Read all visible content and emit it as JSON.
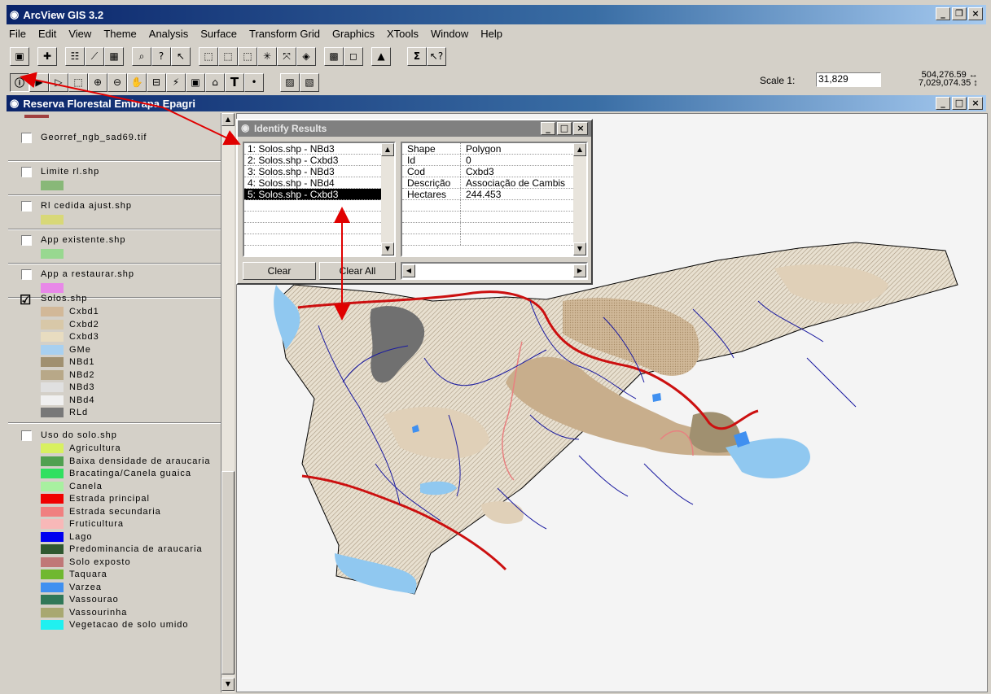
{
  "app": {
    "title": "ArcView GIS 3.2"
  },
  "menu": [
    "File",
    "Edit",
    "View",
    "Theme",
    "Analysis",
    "Surface",
    "Transform Grid",
    "Graphics",
    "XTools",
    "Window",
    "Help"
  ],
  "scale": {
    "label": "Scale 1:",
    "value": "31,829"
  },
  "coords": {
    "x": "504,276.59",
    "y": "7,029,074.35"
  },
  "view": {
    "title": "Reserva Florestal Embrapa Epagri"
  },
  "toc": {
    "layers": [
      {
        "name": "Georref_ngb_sad69.tif",
        "checked": false
      },
      {
        "name": "Limite rl.shp",
        "checked": false,
        "color": "#88b878"
      },
      {
        "name": "Rl cedida ajust.shp",
        "checked": false,
        "color": "#d8d878"
      },
      {
        "name": "App existente.shp",
        "checked": false,
        "color": "#98d890"
      },
      {
        "name": "App a restaurar.shp",
        "checked": false,
        "color": "#e888e8"
      }
    ],
    "solos": {
      "name": "Solos.shp",
      "checked": true,
      "classes": [
        {
          "label": "Cxbd1",
          "color": "#d2b898"
        },
        {
          "label": "Cxbd2",
          "color": "#d8c8a8"
        },
        {
          "label": "Cxbd3",
          "color": "#e8dcc0"
        },
        {
          "label": "GMe",
          "color": "#a8d0f0"
        },
        {
          "label": "NBd1",
          "color": "#a09070"
        },
        {
          "label": "NBd2",
          "color": "#b8a888"
        },
        {
          "label": "NBd3",
          "color": "#e0e0e0"
        },
        {
          "label": "NBd4",
          "color": "#f0f0f0"
        },
        {
          "label": "RLd",
          "color": "#787878"
        }
      ]
    },
    "uso": {
      "name": "Uso do solo.shp",
      "checked": false,
      "classes": [
        {
          "label": "Agricultura",
          "color": "#d8f060"
        },
        {
          "label": "Baixa densidade de araucaria",
          "color": "#50a050"
        },
        {
          "label": "Bracatinga/Canela guaica",
          "color": "#30e060"
        },
        {
          "label": "Canela",
          "color": "#a8f0a0"
        },
        {
          "label": "Estrada principal",
          "color": "#f00000"
        },
        {
          "label": "Estrada secundaria",
          "color": "#f08080"
        },
        {
          "label": "Fruticultura",
          "color": "#f8b8b8"
        },
        {
          "label": "Lago",
          "color": "#0000f0"
        },
        {
          "label": "Predominancia de araucaria",
          "color": "#305830"
        },
        {
          "label": "Solo exposto",
          "color": "#c07878"
        },
        {
          "label": "Taquara",
          "color": "#70b830"
        },
        {
          "label": "Varzea",
          "color": "#4090f0"
        },
        {
          "label": "Vassourao",
          "color": "#307858"
        },
        {
          "label": "Vassourinha",
          "color": "#a8a870"
        },
        {
          "label": "Vegetacao de solo umido",
          "color": "#20f0f0"
        }
      ]
    }
  },
  "identify": {
    "title": "Identify Results",
    "results": [
      "1:  Solos.shp - NBd3",
      "2:  Solos.shp - Cxbd3",
      "3:  Solos.shp - NBd3",
      "4:  Solos.shp - NBd4",
      "5:  Solos.shp - Cxbd3"
    ],
    "selected_index": 4,
    "attributes": [
      {
        "key": "Shape",
        "value": "Polygon"
      },
      {
        "key": "Id",
        "value": "0"
      },
      {
        "key": "Cod",
        "value": "Cxbd3"
      },
      {
        "key": "Descrição",
        "value": "Associação de Cambis"
      },
      {
        "key": "Hectares",
        "value": "244.453"
      }
    ],
    "clear_label": "Clear",
    "clear_all_label": "Clear All"
  },
  "colors": {
    "road_main": "#cc1010",
    "road_secondary": "#e88080",
    "river": "#1a1aa0",
    "water": "#80c0f0"
  }
}
